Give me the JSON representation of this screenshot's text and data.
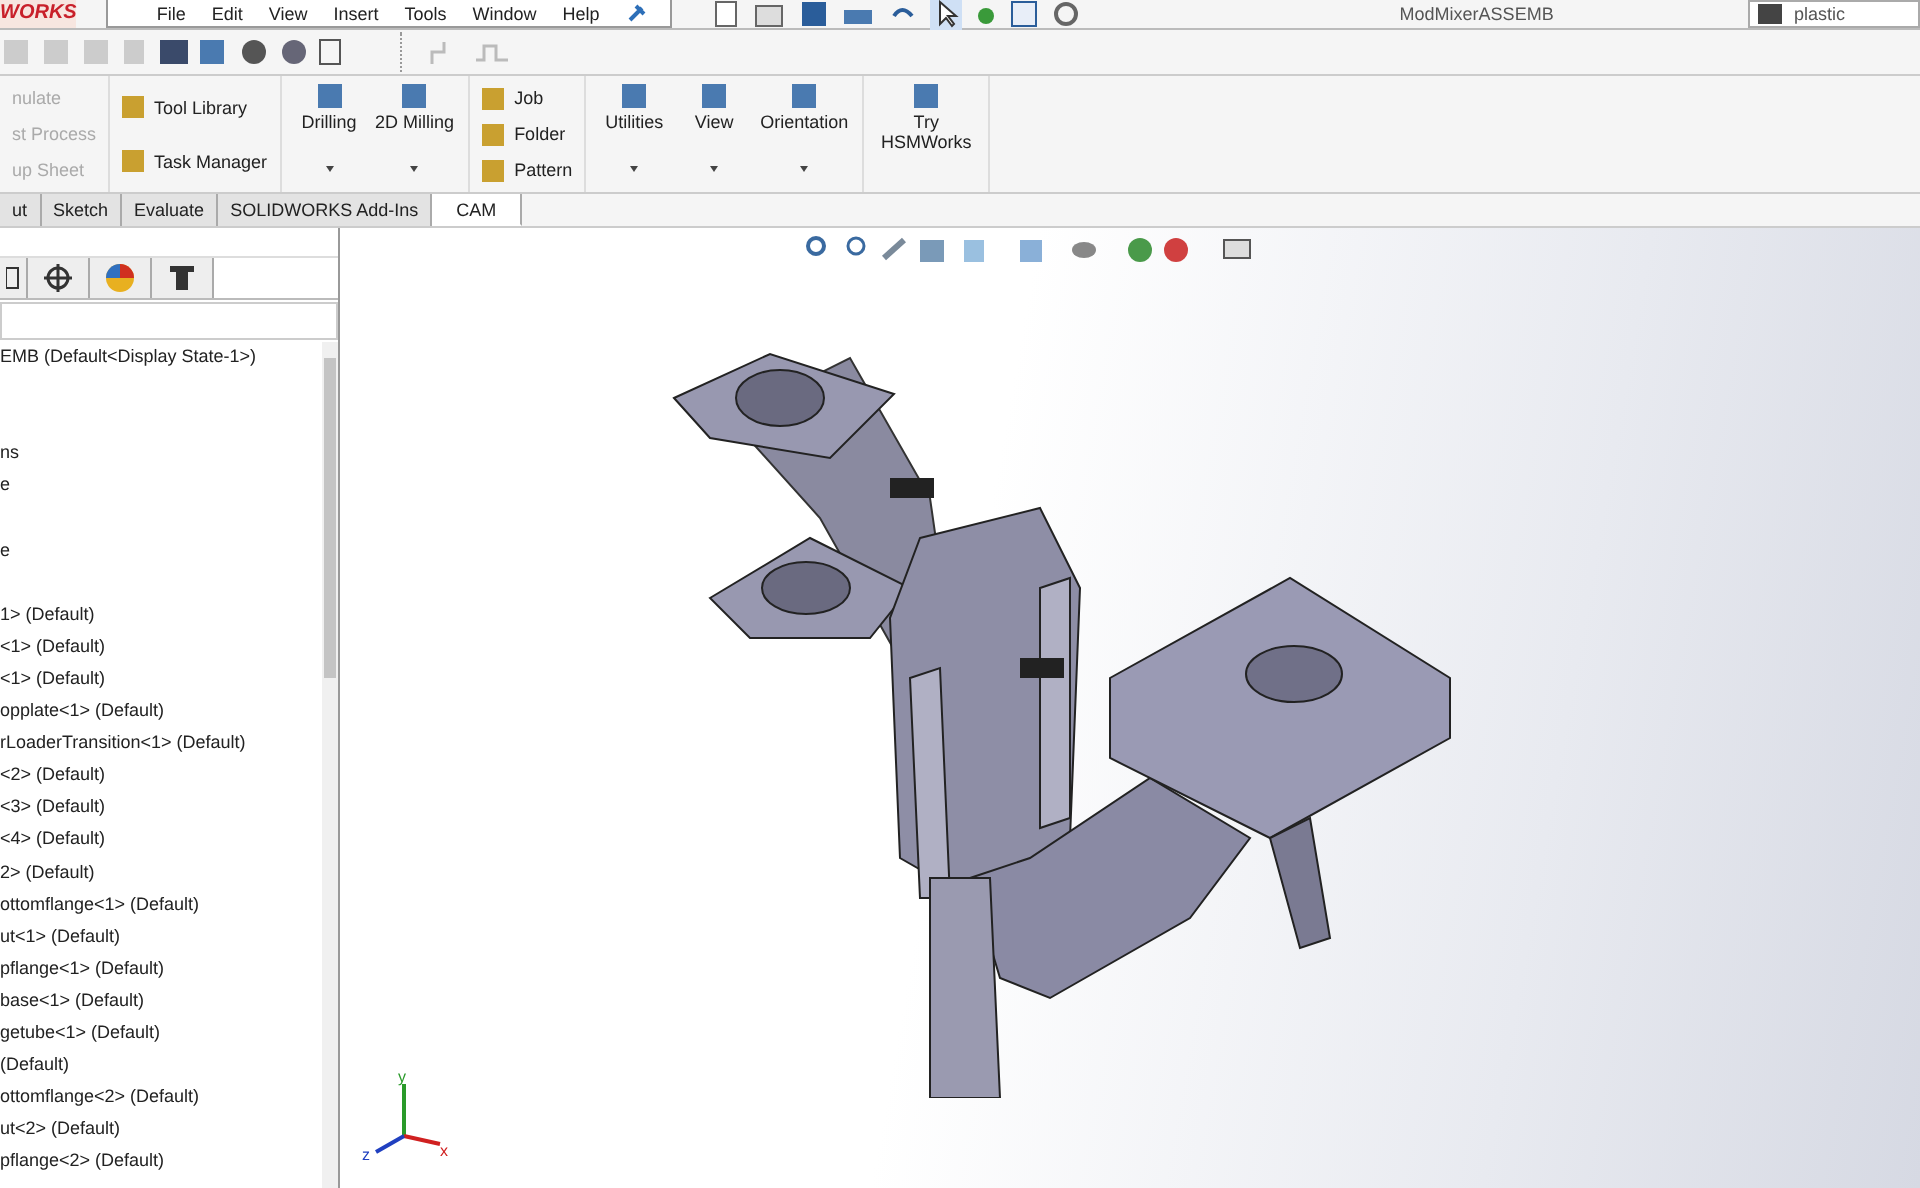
{
  "menu_bar": {
    "logo": "WORKS",
    "menus": [
      "File",
      "Edit",
      "View",
      "Insert",
      "Tools",
      "Window",
      "Help"
    ],
    "document_title": "ModMixerASSEMB",
    "search": {
      "value": "plastic"
    }
  },
  "ribbon": {
    "groups": [
      {
        "kind": "list",
        "items": [
          {
            "label": "nulate",
            "disabled": true
          },
          {
            "label": "st Process",
            "disabled": true
          },
          {
            "label": "up Sheet",
            "disabled": true
          }
        ]
      },
      {
        "kind": "list",
        "items": [
          {
            "label": "Tool Library",
            "disabled": false
          },
          {
            "label": "Task Manager",
            "disabled": false
          }
        ]
      },
      {
        "kind": "big",
        "items": [
          {
            "label": "Drilling",
            "dropdown": true
          },
          {
            "label": "2D Milling",
            "dropdown": true
          }
        ]
      },
      {
        "kind": "list",
        "items": [
          {
            "label": "Job",
            "disabled": false
          },
          {
            "label": "Folder",
            "disabled": false
          },
          {
            "label": "Pattern",
            "disabled": false
          }
        ]
      },
      {
        "kind": "big",
        "items": [
          {
            "label": "Utilities",
            "dropdown": true
          },
          {
            "label": "View",
            "dropdown": true
          },
          {
            "label": "Orientation",
            "dropdown": true
          }
        ]
      },
      {
        "kind": "big",
        "items": [
          {
            "label": "Try HSMWorks",
            "dropdown": false
          }
        ]
      }
    ]
  },
  "tabs": [
    {
      "label": "ut",
      "selected": false
    },
    {
      "label": "Sketch",
      "selected": false
    },
    {
      "label": "Evaluate",
      "selected": false
    },
    {
      "label": "SOLIDWORKS Add-Ins",
      "selected": false
    },
    {
      "label": "CAM",
      "selected": true
    }
  ],
  "tree": {
    "groups": [
      [
        "EMB  (Default<Display State-1>)"
      ],
      [
        "ns",
        "e"
      ],
      [
        "e"
      ],
      [
        "1> (Default)",
        "<1> (Default)",
        "<1> (Default)",
        "opplate<1> (Default)",
        "rLoaderTransition<1> (Default)",
        "<2> (Default)",
        "<3> (Default)",
        "<4> (Default)",
        "2> (Default)",
        "ottomflange<1> (Default)",
        "ut<1> (Default)",
        "pflange<1> (Default)",
        "base<1> (Default)",
        "getube<1> (Default)",
        " (Default)",
        "ottomflange<2> (Default)",
        "ut<2> (Default)",
        "pflange<2> (Default)"
      ]
    ]
  },
  "triad": {
    "x": "x",
    "y": "y",
    "z": "z"
  }
}
